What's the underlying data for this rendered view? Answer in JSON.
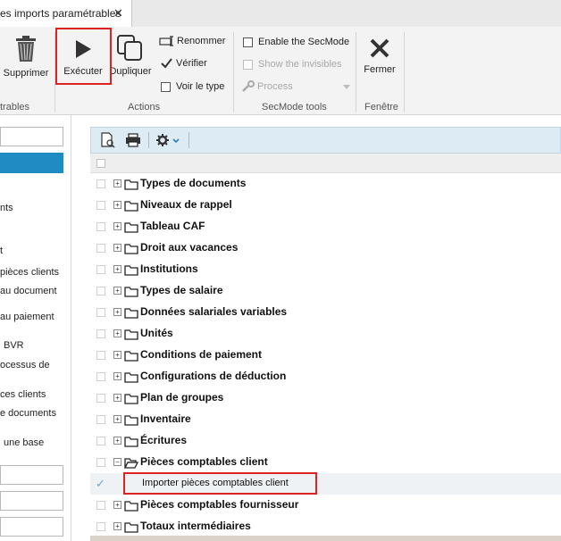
{
  "window": {
    "tab_title": "es imports paramétrables",
    "close_glyph": "✕"
  },
  "ribbon": {
    "buttons": {
      "delete": "Supprimer",
      "execute": "Exécuter",
      "duplicate": "Dupliquer",
      "close": "Fermer"
    },
    "small": {
      "rename": "Renommer",
      "verify": "Vérifier",
      "view_type": "Voir le type",
      "enable_secmode": "Enable the SecMode",
      "show_invisibles": "Show the invisibles",
      "process": "Process"
    },
    "groups": {
      "left": "trables",
      "actions": "Actions",
      "secmode": "SecMode tools",
      "window": "Fenêtre"
    }
  },
  "left_panel": {
    "items": [
      {
        "label": "nts"
      },
      {
        "label": "t"
      },
      {
        "label": "pièces clients"
      },
      {
        "label": "au document"
      },
      {
        "label": "au paiement"
      },
      {
        "label": "BVR"
      },
      {
        "label": "ocessus de"
      },
      {
        "label": "ces clients"
      },
      {
        "label": "e documents"
      },
      {
        "label": "une base"
      }
    ]
  },
  "tree": {
    "rows": [
      {
        "label": "Types de documents",
        "expander": "+"
      },
      {
        "label": "Niveaux de rappel",
        "expander": "+"
      },
      {
        "label": "Tableau CAF",
        "expander": "+"
      },
      {
        "label": "Droit aux vacances",
        "expander": "+"
      },
      {
        "label": "Institutions",
        "expander": "+"
      },
      {
        "label": "Types de salaire",
        "expander": "+"
      },
      {
        "label": "Données salariales variables",
        "expander": "+"
      },
      {
        "label": "Unités",
        "expander": "+"
      },
      {
        "label": "Conditions de paiement",
        "expander": "+"
      },
      {
        "label": "Configurations de déduction",
        "expander": "+"
      },
      {
        "label": "Plan de groupes",
        "expander": "+"
      },
      {
        "label": "Inventaire",
        "expander": "+"
      },
      {
        "label": "Écritures",
        "expander": "+"
      },
      {
        "label": "Pièces comptables client",
        "expander": "−"
      }
    ],
    "child": {
      "label": "Importer pièces comptables client",
      "check": "✓"
    },
    "rows_after": [
      {
        "label": "Pièces comptables fournisseur",
        "expander": "+"
      },
      {
        "label": "Totaux intermédiaires",
        "expander": "+"
      }
    ]
  },
  "colors": {
    "accent_blue": "#1e8bc3",
    "highlight_red": "#d22222",
    "toolbar_bg": "#ddebf5"
  }
}
